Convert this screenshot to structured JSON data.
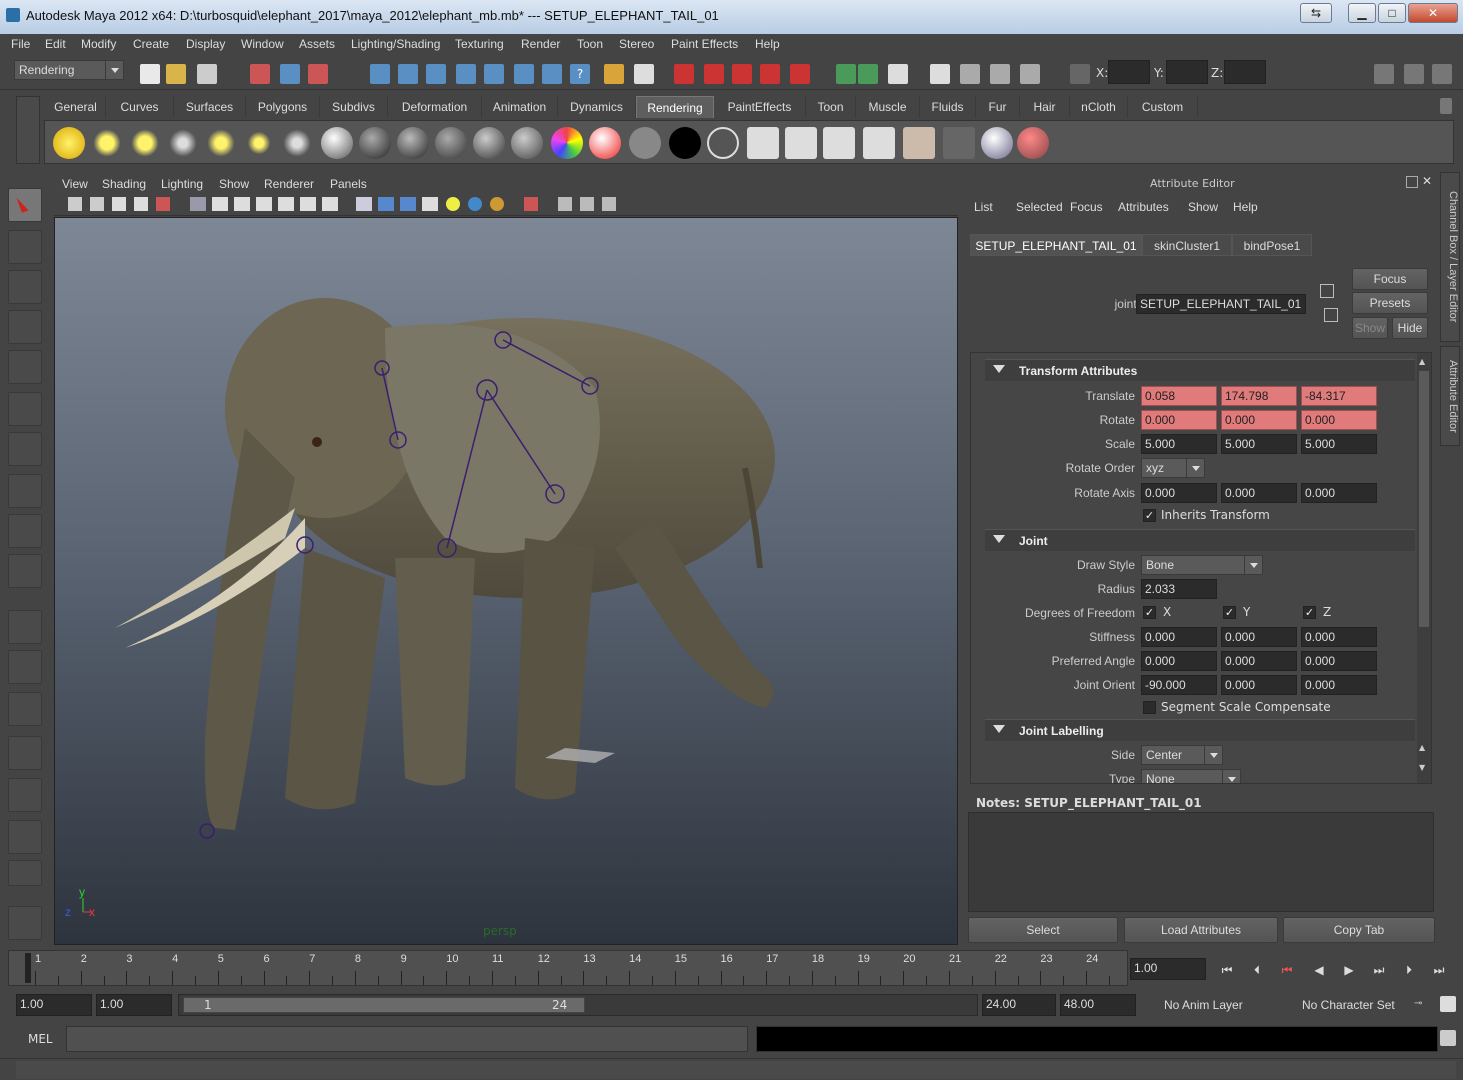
{
  "window": {
    "title": "Autodesk Maya 2012 x64: D:\\turbosquid\\elephant_2017\\maya_2012\\elephant_mb.mb*   ---   SETUP_ELEPHANT_TAIL_01",
    "buttons": [
      "restore",
      "minimize",
      "maximize",
      "close"
    ]
  },
  "menubar": [
    "File",
    "Edit",
    "Modify",
    "Create",
    "Display",
    "Window",
    "Assets",
    "Lighting/Shading",
    "Texturing",
    "Render",
    "Toon",
    "Stereo",
    "Paint Effects",
    "Help"
  ],
  "statusline": {
    "menuset": "Rendering",
    "x_label": "X:",
    "y_label": "Y:",
    "z_label": "Z:"
  },
  "shelf": {
    "tabs": [
      "General",
      "Curves",
      "Surfaces",
      "Polygons",
      "Subdivs",
      "Deformation",
      "Animation",
      "Dynamics",
      "Rendering",
      "PaintEffects",
      "Toon",
      "Muscle",
      "Fluids",
      "Fur",
      "Hair",
      "nCloth",
      "Custom"
    ],
    "active_tab": "Rendering"
  },
  "viewport": {
    "menu": [
      "View",
      "Shading",
      "Lighting",
      "Show",
      "Renderer",
      "Panels"
    ],
    "camera_label": "persp",
    "axis_labels": {
      "y": "y",
      "z": "z",
      "x": "x"
    }
  },
  "attribute_editor": {
    "header": "Attribute Editor",
    "menu": [
      "List",
      "Selected",
      "Focus",
      "Attributes",
      "Show",
      "Help"
    ],
    "tabs": [
      "SETUP_ELEPHANT_TAIL_01",
      "skinCluster1",
      "bindPose1"
    ],
    "node_type_label": "joint:",
    "node_name": "SETUP_ELEPHANT_TAIL_01",
    "buttons": {
      "focus": "Focus",
      "presets": "Presets",
      "show": "Show",
      "hide": "Hide"
    },
    "sections": {
      "transform": "Transform Attributes",
      "joint": "Joint",
      "labelling": "Joint Labelling"
    },
    "transform": {
      "translate": {
        "label": "Translate",
        "values": [
          "0.058",
          "174.798",
          "-84.317"
        ]
      },
      "rotate": {
        "label": "Rotate",
        "values": [
          "0.000",
          "0.000",
          "0.000"
        ]
      },
      "scale": {
        "label": "Scale",
        "values": [
          "5.000",
          "5.000",
          "5.000"
        ]
      },
      "rotate_order": {
        "label": "Rotate Order",
        "value": "xyz"
      },
      "rotate_axis": {
        "label": "Rotate Axis",
        "values": [
          "0.000",
          "0.000",
          "0.000"
        ]
      },
      "inherits": "Inherits Transform"
    },
    "joint": {
      "draw_style": {
        "label": "Draw Style",
        "value": "Bone"
      },
      "radius": {
        "label": "Radius",
        "value": "2.033"
      },
      "dof": {
        "label": "Degrees of Freedom",
        "axes": [
          "X",
          "Y",
          "Z"
        ]
      },
      "stiffness": {
        "label": "Stiffness",
        "values": [
          "0.000",
          "0.000",
          "0.000"
        ]
      },
      "preferred_angle": {
        "label": "Preferred Angle",
        "values": [
          "0.000",
          "0.000",
          "0.000"
        ]
      },
      "joint_orient": {
        "label": "Joint Orient",
        "values": [
          "-90.000",
          "0.000",
          "0.000"
        ]
      },
      "segment_scale": "Segment Scale Compensate"
    },
    "labelling": {
      "side": {
        "label": "Side",
        "value": "Center"
      },
      "type": {
        "label": "Type",
        "value": "None"
      }
    },
    "notes_label": "Notes:  SETUP_ELEPHANT_TAIL_01",
    "bottom_buttons": [
      "Select",
      "Load Attributes",
      "Copy Tab"
    ]
  },
  "side_tabs": [
    "Channel Box / Layer Editor",
    "Attribute Editor"
  ],
  "timeline": {
    "frames": [
      "1",
      "2",
      "3",
      "4",
      "5",
      "6",
      "7",
      "8",
      "9",
      "10",
      "11",
      "12",
      "13",
      "14",
      "15",
      "16",
      "17",
      "18",
      "19",
      "20",
      "21",
      "22",
      "23",
      "24"
    ],
    "current_frame": "1.00"
  },
  "range": {
    "start": "1.00",
    "playback_start": "1.00",
    "slider_start": "1",
    "slider_end": "24",
    "playback_end": "24.00",
    "end": "48.00",
    "anim_layer": "No Anim Layer",
    "character_set": "No Character Set"
  },
  "command_line": {
    "label": "MEL"
  }
}
